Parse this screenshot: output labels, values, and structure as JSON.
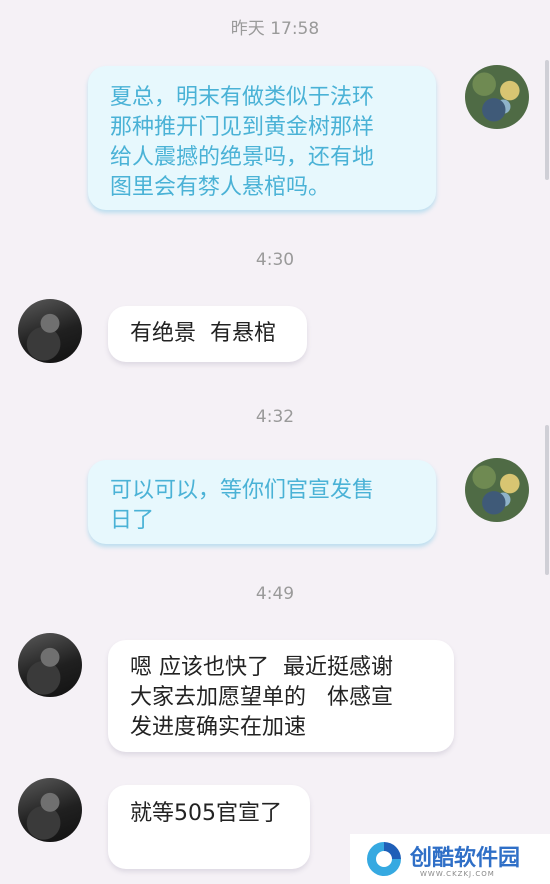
{
  "messages": [
    {
      "timestamp": "昨天 17:58",
      "sender": "self",
      "text": "夏总，明末有做类似于法环\n那种推开门见到黄金树那样\n给人震撼的绝景吗，还有地\n图里会有棼人悬棺吗。"
    },
    {
      "timestamp": "4:30",
      "sender": "other",
      "text": "有绝景  有悬棺"
    },
    {
      "timestamp": "4:32",
      "sender": "self",
      "text": "可以可以，等你们官宣发售\n日了"
    },
    {
      "timestamp": "4:49",
      "sender": "other",
      "text": "嗯 应该也快了  最近挺感谢\n大家去加愿望单的   体感宣\n发进度确实在加速"
    },
    {
      "timestamp": "",
      "sender": "other",
      "text": "就等505官宣了"
    }
  ],
  "watermark": {
    "title": "创酷软件园",
    "url": "WWW.CKZKJ.COM"
  },
  "colors": {
    "background": "#f5f1f6",
    "self_bubble": "#e7f8fd",
    "self_text": "#4ab2d6",
    "other_bubble": "#ffffff",
    "other_text": "#222222",
    "timestamp_text": "#9a9a9a",
    "watermark_text": "#2f6fc7"
  }
}
